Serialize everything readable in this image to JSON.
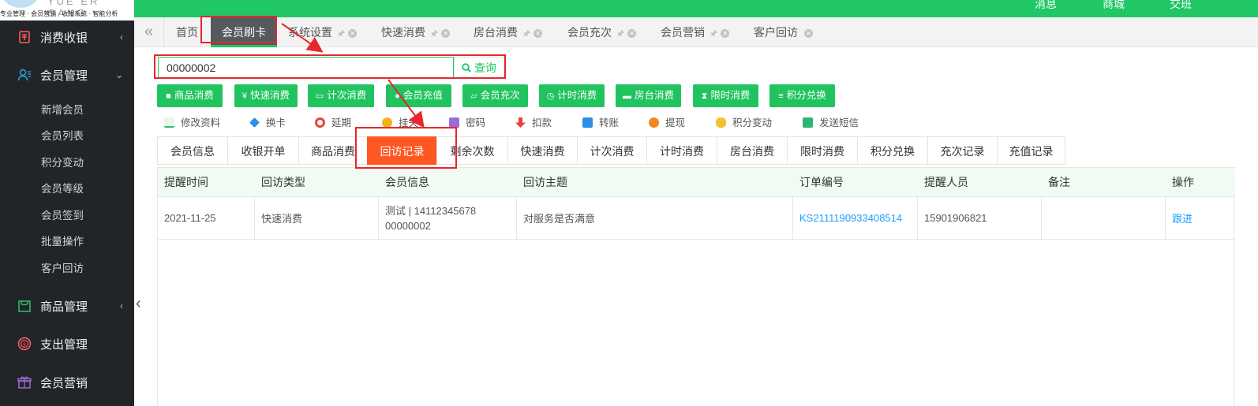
{
  "app": {
    "brand": "YUE ER GANG",
    "slogan": "专业管理 · 会员营销 · 收银系统 · 智能分析"
  },
  "topbar": {
    "messages": "消息",
    "mall": "商城",
    "handover": "交班"
  },
  "sidebar": {
    "groups": [
      {
        "label": "消费收银",
        "icon": "cashier-icon",
        "arrow": "‹"
      },
      {
        "label": "会员管理",
        "icon": "member-icon",
        "arrow": "⌄"
      },
      {
        "label": "商品管理",
        "icon": "goods-icon",
        "arrow": "‹"
      },
      {
        "label": "支出管理",
        "icon": "expense-icon",
        "arrow": ""
      },
      {
        "label": "会员营销",
        "icon": "gift-icon",
        "arrow": ""
      }
    ],
    "member_items": [
      "新增会员",
      "会员列表",
      "积分变动",
      "会员等级",
      "会员签到",
      "批量操作",
      "客户回访"
    ]
  },
  "tabs": {
    "back": "«",
    "items": [
      "首页",
      "会员刷卡",
      "系统设置",
      "快速消费",
      "房台消费",
      "会员充次",
      "会员营销",
      "客户回访"
    ],
    "pin": "🖈",
    "close": "✕"
  },
  "search": {
    "value": "00000002",
    "button": "查询",
    "icon": "search-icon"
  },
  "actions": [
    "商品消费",
    "快速消费",
    "计次消费",
    "会员充值",
    "会员充次",
    "计时消费",
    "房台消费",
    "限时消费",
    "积分兑换"
  ],
  "action_icons": [
    "bag-icon",
    "yen-icon",
    "card-icon",
    "coin-icon",
    "inbox-icon",
    "clock-icon",
    "cup-icon",
    "hourglass-icon",
    "database-icon"
  ],
  "links": [
    "修改资料",
    "换卡",
    "延期",
    "挂失",
    "密码",
    "扣款",
    "转账",
    "提现",
    "积分变动",
    "发送短信"
  ],
  "record_tabs": [
    "会员信息",
    "收银开单",
    "商品消费",
    "回访记录",
    "剩余次数",
    "快速消费",
    "计次消费",
    "计时消费",
    "房台消费",
    "限时消费",
    "积分兑换",
    "充次记录",
    "充值记录"
  ],
  "table": {
    "headers": [
      "提醒时间",
      "回访类型",
      "会员信息",
      "回访主题",
      "订单编号",
      "提醒人员",
      "备注",
      "操作"
    ],
    "rows": [
      {
        "time": "2021-11-25",
        "type": "快速消费",
        "member_line1": "测试 | 14112345678",
        "member_line2": "00000002",
        "topic": "对服务是否满意",
        "order": "KS2111190933408514",
        "staff": "15901906821",
        "note": "",
        "action": "跟进"
      }
    ]
  },
  "colors": {
    "accent": "#20c764",
    "active_tab": "#ff5722",
    "sidebar": "#222528",
    "annotation": "#e8262c",
    "link": "#1e9fff"
  }
}
